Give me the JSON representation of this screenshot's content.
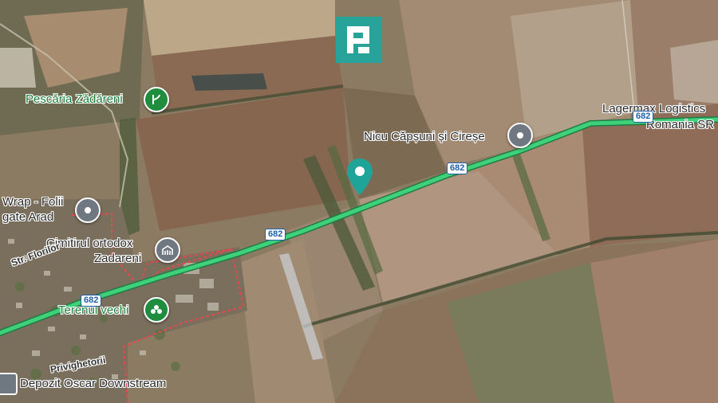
{
  "map": {
    "road_number": "682",
    "road_color": "#3fd17a",
    "boundary_color": "#e5484d"
  },
  "places": {
    "pescaria": "Pescăria Zădăreni",
    "nicu": "Nicu Căpșuni și Cireșe",
    "lagermax_line1": "Lagermax Logistics",
    "lagermax_line2": "Romania SR",
    "wrap_line1": "Wrap - Folii",
    "wrap_line2": "gate Arad",
    "cimitirul_line1": "Cimitirul ortodox",
    "cimitirul_line2": "Zadareni",
    "terenul": "Terenul vechi",
    "depozit": "Depozit Oscar Downstream",
    "str_florilor": "Str. Florilor",
    "privighetorii": "Privighetorii"
  },
  "icons": {
    "logo": "brand-square-logo",
    "fishing": "fishing-place-icon",
    "generic": "location-pin-icon",
    "cemetery": "cemetery-icon",
    "park": "park-icon",
    "selected": "selected-location-marker",
    "store": "store-icon"
  },
  "colors": {
    "brand_teal": "#27a39a",
    "marker_teal": "#1fa49a",
    "pin_gray": "#6f7780",
    "pin_green": "#1e8e3e"
  }
}
